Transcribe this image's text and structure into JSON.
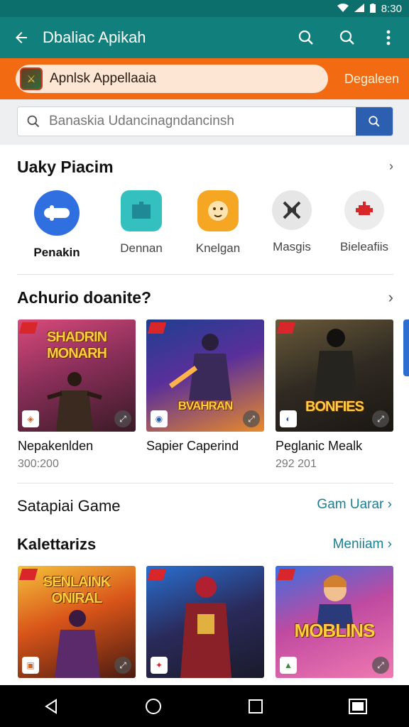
{
  "status_bar": {
    "time": "8:30"
  },
  "app_bar": {
    "title": "Dbaliac Apikah"
  },
  "banner": {
    "text": "Apnlsk Appellaaia",
    "action": "Degaleen"
  },
  "search": {
    "placeholder": "Banaskia Udancinagndancinsh"
  },
  "categories": {
    "title": "Uaky Piacim",
    "items": [
      {
        "label": "Penakin",
        "icon": "controller-icon",
        "color": "#2f6fe0"
      },
      {
        "label": "Dennan",
        "icon": "puzzle-icon",
        "color": "#35c0c0"
      },
      {
        "label": "Knelgan",
        "icon": "lion-icon",
        "color": "#f5a623"
      },
      {
        "label": "Masgis",
        "icon": "crossed-swords-icon",
        "color": "#e6e6e6"
      },
      {
        "label": "Bieleafiis",
        "icon": "robot-icon",
        "color": "#e8e8e8"
      }
    ]
  },
  "featured": {
    "title": "Achurio doanite?",
    "items": [
      {
        "name": "Nepakenlden",
        "meta": "300:200",
        "art_title": "SHADRIN MONARH"
      },
      {
        "name": "Sapier Caperind",
        "meta": "",
        "art_title": "BVAHRAN"
      },
      {
        "name": "Peglanic Mealk",
        "meta": "292 201",
        "art_title": "BONFIES"
      }
    ]
  },
  "section2": {
    "title": "Satapiai Game",
    "link": "Gam Uarar"
  },
  "section3": {
    "title": "Kalettarizs",
    "link": "Meniiam",
    "items": [
      {
        "art_title": "SENLAINK ONIRAL"
      },
      {
        "art_title": ""
      },
      {
        "art_title": "MOBLINS"
      }
    ]
  }
}
